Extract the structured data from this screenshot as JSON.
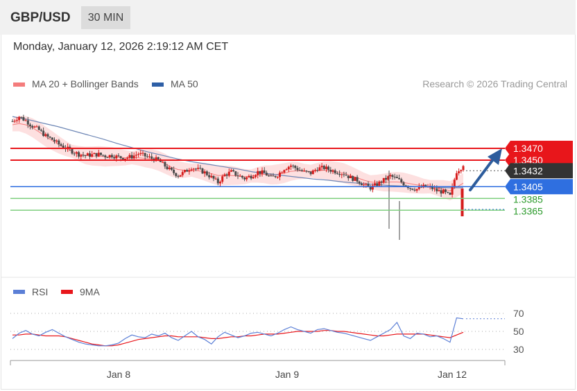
{
  "header": {
    "symbol": "GBP/USD",
    "interval": "30 MIN"
  },
  "timestamp": "Monday, January 12, 2026 2:19:12 AM CET",
  "legend": [
    {
      "label": "MA 20 + Bollinger Bands",
      "color": "#f47c7c"
    },
    {
      "label": "MA 50",
      "color": "#2e5fa6"
    }
  ],
  "copyright": "Research © 2026 Trading Central",
  "colors": {
    "resistance": "#e8161b",
    "pivot": "#2f6fe0",
    "support": "#7fcf7f",
    "current": "#333333",
    "up": "#d61d1d",
    "down": "#4a4a4a",
    "arrow": "#2d5c9c",
    "rsi": "#5b7fd6",
    "rsi_ma": "#e8161b"
  },
  "chart_data": [
    {
      "type": "candlestick",
      "x_labels": [
        "Jan 8",
        "Jan 9",
        "Jan 12"
      ],
      "levels": [
        {
          "value": 1.347,
          "label": "1.3470",
          "kind": "resistance"
        },
        {
          "value": 1.345,
          "label": "1.3450",
          "kind": "resistance"
        },
        {
          "value": 1.3432,
          "label": "1.3432",
          "kind": "current"
        },
        {
          "value": 1.3405,
          "label": "1.3405",
          "kind": "pivot"
        },
        {
          "value": 1.3385,
          "label": "1.3385",
          "kind": "support"
        },
        {
          "value": 1.3365,
          "label": "1.3365",
          "kind": "support"
        }
      ],
      "close_path": [
        1.3516,
        1.3524,
        1.3517,
        1.3508,
        1.3501,
        1.3491,
        1.3485,
        1.3477,
        1.3471,
        1.3465,
        1.346,
        1.3458,
        1.3459,
        1.346,
        1.3457,
        1.3458,
        1.3455,
        1.3454,
        1.3456,
        1.3461,
        1.3457,
        1.3453,
        1.345,
        1.344,
        1.3431,
        1.3424,
        1.343,
        1.3438,
        1.3434,
        1.3429,
        1.3421,
        1.3412,
        1.3425,
        1.343,
        1.3424,
        1.3419,
        1.3423,
        1.343,
        1.3428,
        1.342,
        1.3425,
        1.3436,
        1.3441,
        1.3435,
        1.343,
        1.3428,
        1.3436,
        1.3437,
        1.3433,
        1.343,
        1.3427,
        1.342,
        1.3416,
        1.3408,
        1.3403,
        1.3409,
        1.3416,
        1.3423,
        1.3418,
        1.341,
        1.3403,
        1.3401,
        1.3405,
        1.3404,
        1.3398,
        1.3396,
        1.3389,
        1.3431,
        1.344
      ],
      "ma20_path": [
        1.351,
        1.3512,
        1.351,
        1.3505,
        1.3498,
        1.349,
        1.3483,
        1.3476,
        1.347,
        1.3465,
        1.3461,
        1.3458,
        1.3457,
        1.3457,
        1.3456,
        1.3456,
        1.3455,
        1.3454,
        1.3454,
        1.3454,
        1.3453,
        1.3452,
        1.3449,
        1.3444,
        1.3438,
        1.3434,
        1.3433,
        1.3433,
        1.3432,
        1.343,
        1.3427,
        1.3424,
        1.3424,
        1.3424,
        1.3423,
        1.3422,
        1.3423,
        1.3425,
        1.3426,
        1.3425,
        1.3426,
        1.3428,
        1.3431,
        1.3432,
        1.3431,
        1.3431,
        1.3432,
        1.3433,
        1.3432,
        1.343,
        1.3428,
        1.3424,
        1.342,
        1.3416,
        1.3413,
        1.3412,
        1.3412,
        1.3413,
        1.3413,
        1.3412,
        1.341,
        1.3408,
        1.3406,
        1.3405,
        1.3403,
        1.3401,
        1.3398,
        1.3404,
        1.3411
      ],
      "ma50_path": [
        1.3524,
        1.3519,
        1.3513,
        1.3507,
        1.35,
        1.3493,
        1.3486,
        1.3478,
        1.3471,
        1.3464,
        1.3458,
        1.3452,
        1.3447,
        1.3443,
        1.3439,
        1.3435,
        1.343,
        1.3427,
        1.3424,
        1.3421,
        1.3418,
        1.3416,
        1.3413,
        1.3411,
        1.3409,
        1.3407,
        1.3406,
        1.3405,
        1.3404,
        1.3403,
        1.3403
      ],
      "rsi": {
        "ticks": [
          70,
          50,
          30
        ],
        "ylim": [
          30,
          70
        ],
        "rsi_path": [
          42,
          48,
          51,
          47,
          45,
          49,
          52,
          48,
          44,
          41,
          38,
          36,
          35,
          34,
          34,
          35,
          37,
          42,
          46,
          44,
          43,
          47,
          45,
          48,
          43,
          40,
          45,
          50,
          44,
          41,
          36,
          44,
          49,
          46,
          43,
          45,
          48,
          49,
          47,
          45,
          48,
          52,
          55,
          52,
          50,
          48,
          52,
          53,
          51,
          49,
          48,
          46,
          44,
          42,
          40,
          44,
          48,
          52,
          60,
          45,
          42,
          48,
          47,
          44,
          45,
          42,
          38,
          65,
          64
        ],
        "rsi_ma_path": [
          46,
          46,
          47,
          47,
          46,
          45,
          45,
          45,
          44,
          42,
          40,
          38,
          36,
          35,
          34,
          34,
          35,
          37,
          39,
          41,
          42,
          43,
          44,
          45,
          45,
          44,
          44,
          44,
          44,
          43,
          42,
          42,
          43,
          44,
          44,
          45,
          45,
          46,
          47,
          47,
          47,
          48,
          49,
          50,
          50,
          50,
          50,
          51,
          51,
          50,
          50,
          49,
          48,
          47,
          46,
          45,
          45,
          46,
          47,
          47,
          47,
          47,
          47,
          46,
          45,
          44,
          43,
          46,
          49
        ]
      }
    }
  ]
}
